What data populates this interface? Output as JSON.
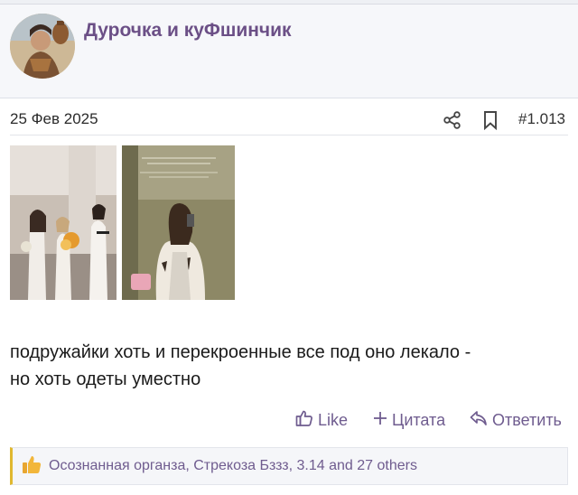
{
  "post": {
    "username": "Дурочка и куФшинчик",
    "date": "25 Фев 2025",
    "number": "#1.013",
    "body_line_1": "подружайки хоть и перекроенные все под оно лекало -",
    "body_line_2": "но хоть одеты уместно"
  },
  "actions": {
    "like": "Like",
    "quote": "Цитата",
    "reply": "Ответить"
  },
  "reactions": {
    "text": "Осознанная органза, Стрекоза Бззз, 3.14 and 27 others"
  },
  "colors": {
    "username": "#6b4f86",
    "action": "#6f5c8f",
    "reaction_accent": "#e0b830",
    "header_bg": "#f6f7fa"
  },
  "icons": [
    "share-icon",
    "bookmark-icon",
    "thumbs-up-icon",
    "plus-icon",
    "reply-icon",
    "thumbs-up-reaction-icon"
  ]
}
